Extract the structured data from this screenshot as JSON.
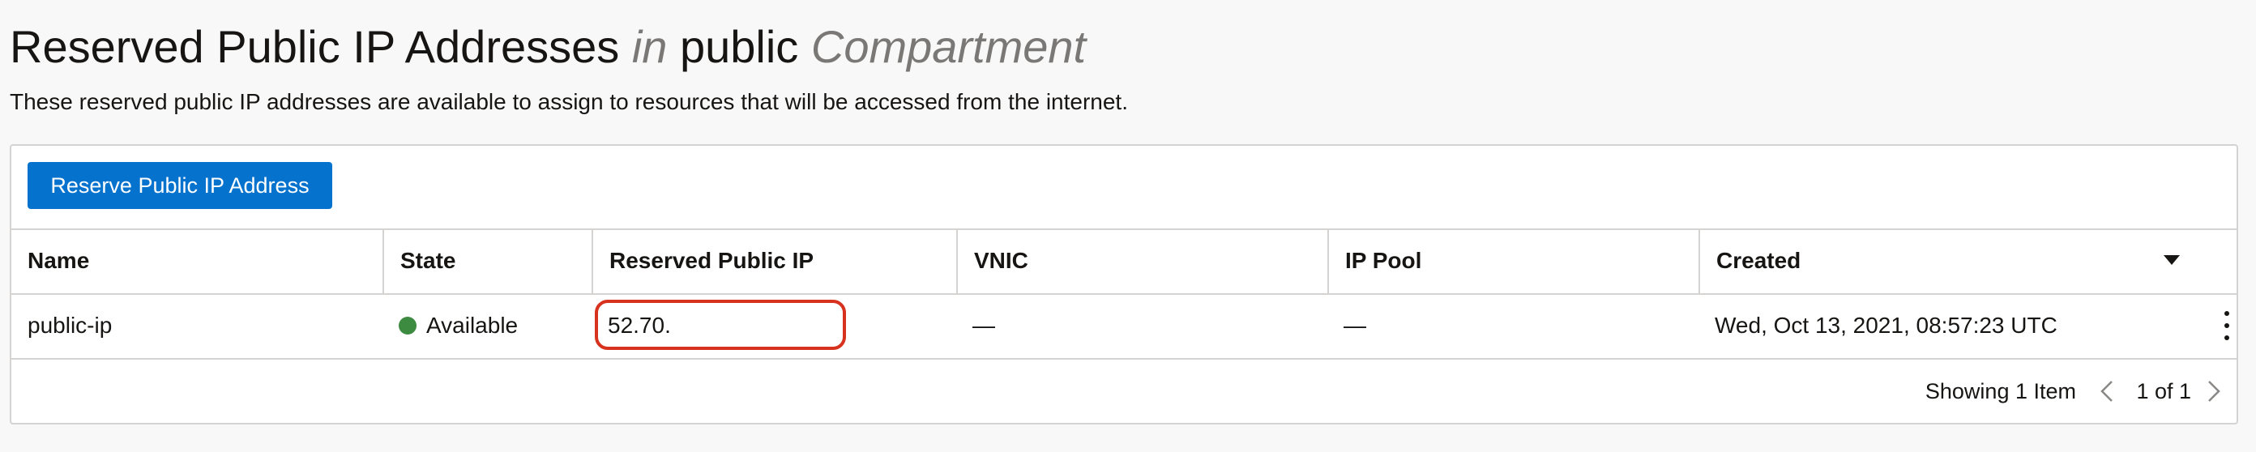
{
  "header": {
    "title_main": "Reserved Public IP Addresses",
    "title_in": "in",
    "title_compartment_name": "public",
    "title_compartment_label": "Compartment",
    "description": "These reserved public IP addresses are available to assign to resources that will be accessed from the internet."
  },
  "toolbar": {
    "reserve_button_label": "Reserve Public IP Address"
  },
  "table": {
    "columns": {
      "name": "Name",
      "state": "State",
      "reserved_ip": "Reserved Public IP",
      "vnic": "VNIC",
      "ip_pool": "IP Pool",
      "created": "Created"
    },
    "sort_icon": "caret-down-icon",
    "rows": [
      {
        "name": "public-ip",
        "state": "Available",
        "state_color": "#3d8b40",
        "reserved_ip": "52.70.",
        "vnic": "—",
        "ip_pool": "—",
        "created": "Wed, Oct 13, 2021, 08:57:23 UTC",
        "actions_icon": "kebab-menu-icon"
      }
    ]
  },
  "footer": {
    "count_text": "Showing 1 Item",
    "page_text": "1 of 1",
    "prev_icon": "chevron-left-icon",
    "next_icon": "chevron-right-icon"
  },
  "colors": {
    "primary": "#0572ce",
    "highlight": "#d7321e",
    "available": "#3d8b40"
  }
}
